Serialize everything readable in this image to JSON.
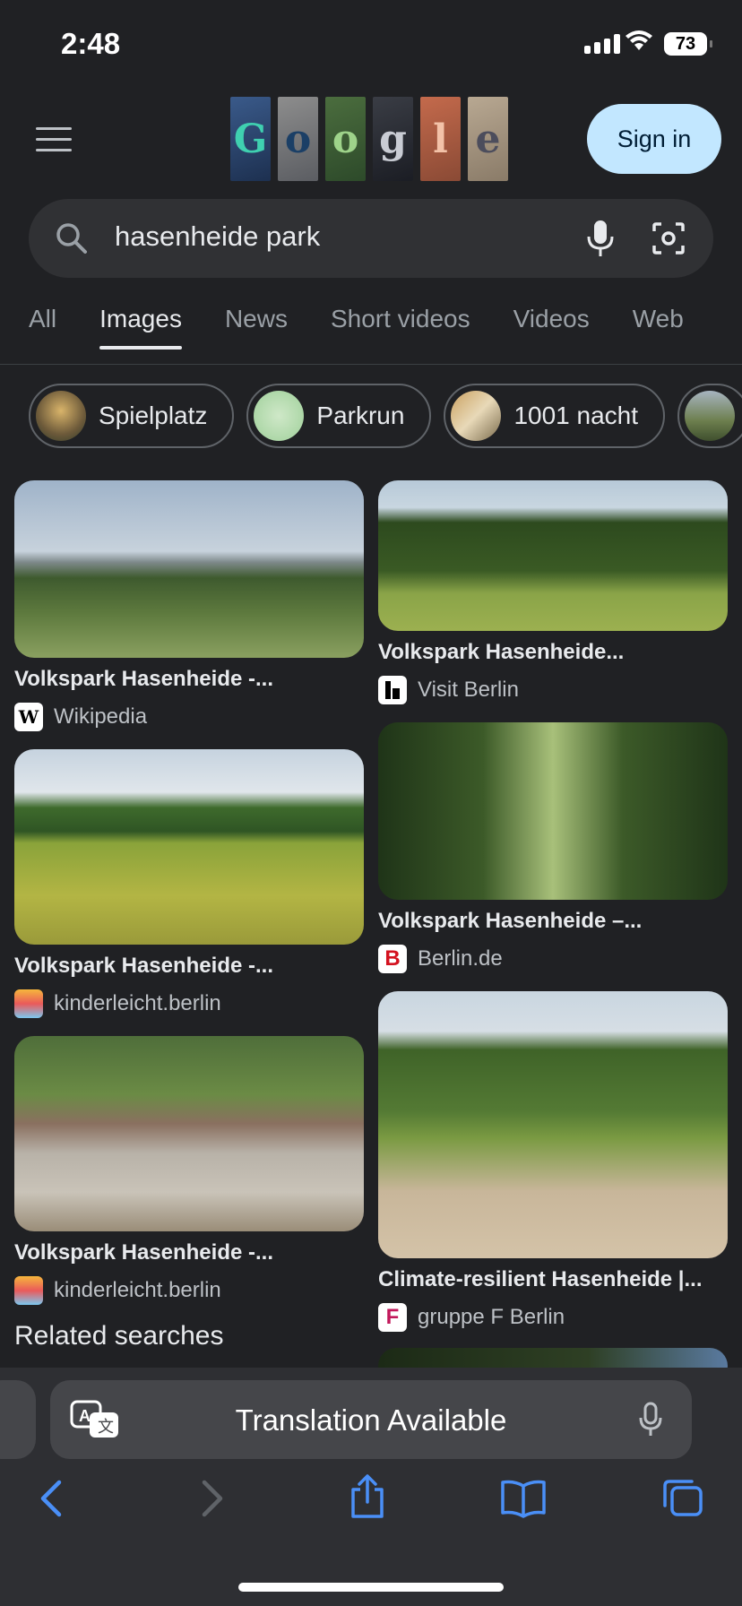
{
  "status_bar": {
    "time": "2:48",
    "battery": "73"
  },
  "header": {
    "logo_letters": [
      "G",
      "o",
      "o",
      "g",
      "l",
      "e"
    ],
    "sign_in_label": "Sign in"
  },
  "search": {
    "query": "hasenheide park"
  },
  "tabs": [
    {
      "label": "All",
      "active": false
    },
    {
      "label": "Images",
      "active": true
    },
    {
      "label": "News",
      "active": false
    },
    {
      "label": "Short videos",
      "active": false
    },
    {
      "label": "Videos",
      "active": false
    },
    {
      "label": "Web",
      "active": false
    }
  ],
  "chips": [
    {
      "label": "Spielplatz"
    },
    {
      "label": "Parkrun"
    },
    {
      "label": "1001 nacht"
    },
    {
      "label": ""
    }
  ],
  "results": [
    {
      "title": "Volkspark Hasenheide -...",
      "source": "Wikipedia",
      "favicon": "W"
    },
    {
      "title": "Volkspark Hasenheide...",
      "source": "Visit Berlin",
      "favicon": ""
    },
    {
      "title": "Volkspark Hasenheide -...",
      "source": "kinderleicht.berlin",
      "favicon": ""
    },
    {
      "title": "Volkspark Hasenheide –...",
      "source": "Berlin.de",
      "favicon": "B"
    },
    {
      "title": "Volkspark Hasenheide -...",
      "source": "kinderleicht.berlin",
      "favicon": ""
    },
    {
      "title": "Climate-resilient Hasenheide |...",
      "source": "gruppe F Berlin",
      "favicon": "F"
    }
  ],
  "related_searches_label": "Related searches",
  "translation_bar": {
    "label": "Translation Available"
  },
  "colors": {
    "background": "#202124",
    "sign_in_bg": "#c2e7ff",
    "toolbar_accent": "#4a8ff7"
  },
  "icons": [
    "menu-icon",
    "search-icon",
    "mic-icon",
    "lens-icon",
    "translate-icon",
    "back-icon",
    "forward-icon",
    "share-icon",
    "bookmarks-icon",
    "tabs-icon"
  ]
}
